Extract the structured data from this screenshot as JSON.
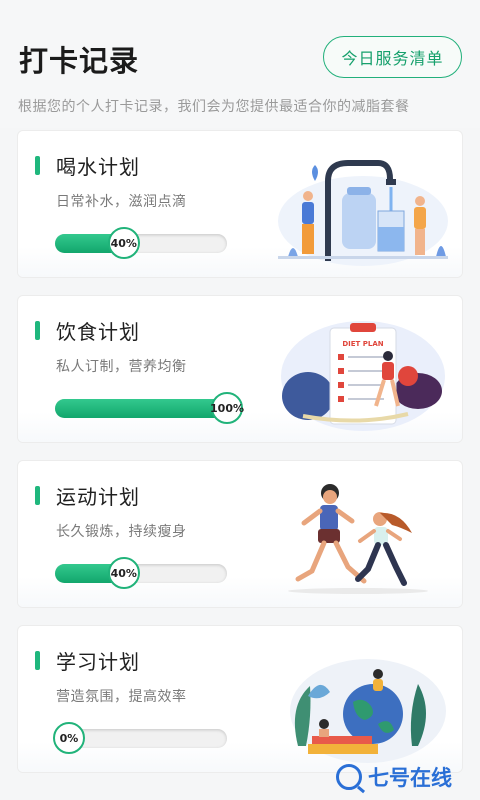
{
  "header": {
    "title": "打卡记录",
    "service_button": "今日服务清单",
    "subtitle": "根据您的个人打卡记录，我们会为您提供最适合你的减脂套餐"
  },
  "plans": [
    {
      "name": "喝水计划",
      "desc": "日常补水，滋润点滴",
      "progress_label": "40%",
      "progress": 0.4
    },
    {
      "name": "饮食计划",
      "desc": "私人订制，营养均衡",
      "progress_label": "100%",
      "progress": 1.0,
      "illustration_text": "DIET PLAN"
    },
    {
      "name": "运动计划",
      "desc": "长久锻炼，持续瘦身",
      "progress_label": "40%",
      "progress": 0.4
    },
    {
      "name": "学习计划",
      "desc": "营造氛围，提高效率",
      "progress_label": "0%",
      "progress": 0.0
    }
  ],
  "watermark": {
    "text": "七号在线"
  },
  "colors": {
    "accent": "#1fb77d",
    "watermark": "#2a6fd6"
  }
}
